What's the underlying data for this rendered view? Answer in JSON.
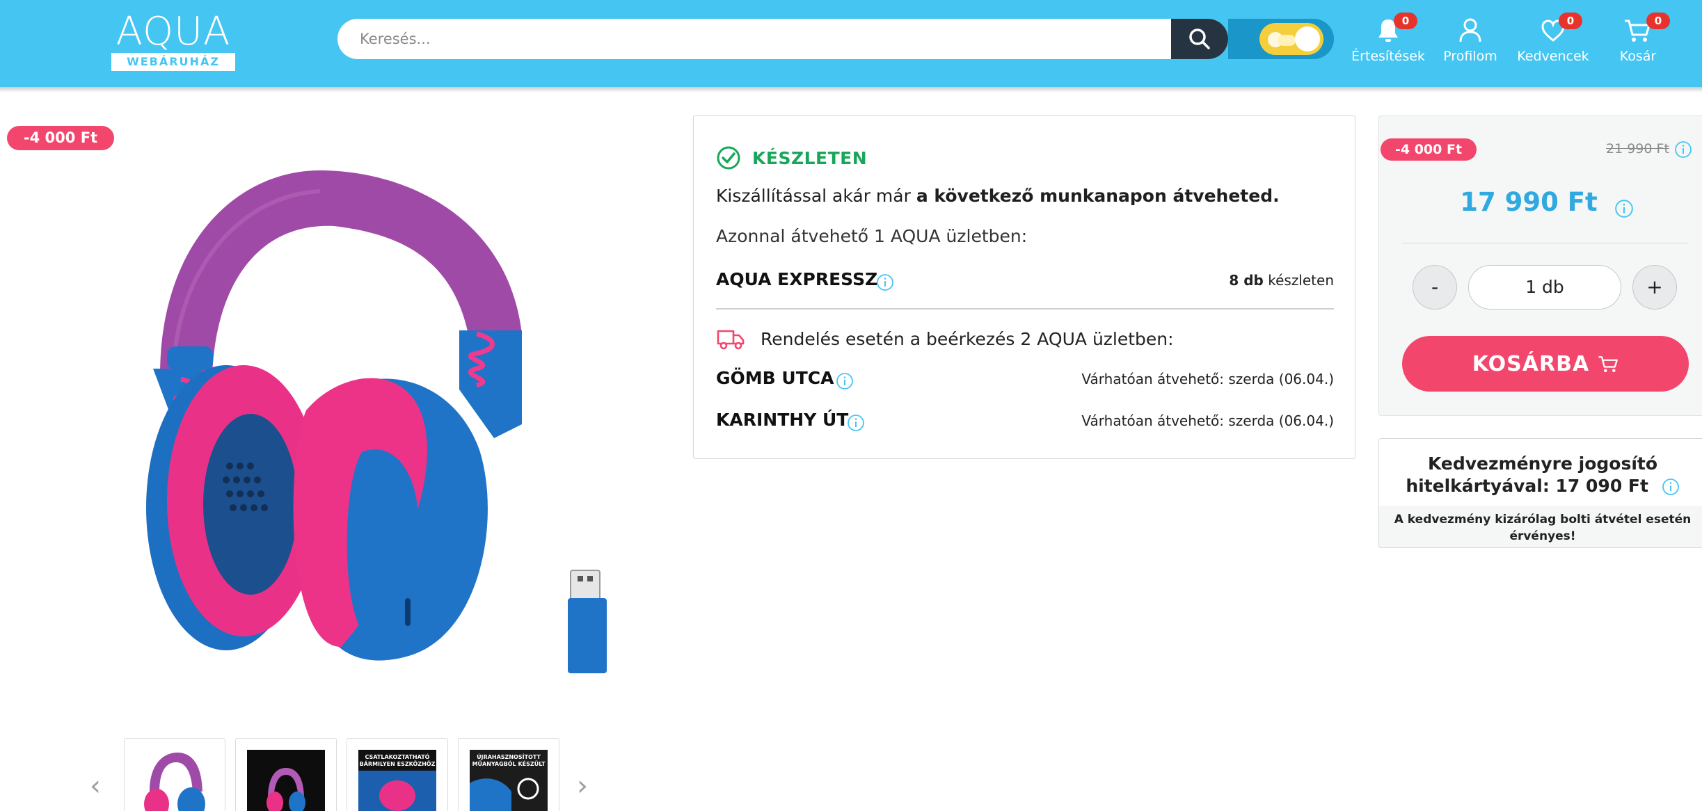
{
  "header": {
    "logo_text": "AQUA",
    "logo_subtitle": "WEBÁRUHÁZ",
    "search_placeholder": "Keresés...",
    "items": [
      {
        "label": "Értesítések",
        "badge": "0",
        "icon": "bell-icon"
      },
      {
        "label": "Profilom",
        "icon": "user-icon"
      },
      {
        "label": "Kedvencek",
        "badge": "0",
        "icon": "heart-icon"
      },
      {
        "label": "Kosár",
        "badge": "0",
        "icon": "cart-icon"
      }
    ],
    "accent_color": "#45c5f1",
    "badge_color": "#e7332c"
  },
  "gallery": {
    "discount_badge": "-4 000 Ft",
    "thumbnails": [
      {
        "text": ""
      },
      {
        "text": ""
      },
      {
        "text": "CSATLAKOZTATHATÓ BÁRMILYEN ESZKÖZHÖZ"
      },
      {
        "text": "ÚJRAHASZNOSÍTOTT MŰANYAGBÓL KÉSZÜLT"
      }
    ]
  },
  "availability": {
    "status": "KÉSZLETEN",
    "delivery_text_prefix": "Kiszállítással akár már ",
    "delivery_text_bold": "a következő munkanapon átveheted.",
    "immediate_text": "Azonnal átvehető 1 AQUA üzletben:",
    "stores_immediate": [
      {
        "name": "AQUA EXPRESSZ",
        "qty": "8 db",
        "qty_suffix": "készleten"
      }
    ],
    "order_text": "Rendelés esetén a beérkezés 2 AQUA üzletben:",
    "stores_order": [
      {
        "name": "GÖMB UTCA",
        "eta": "Várhatóan átvehető: szerda (06.04.)"
      },
      {
        "name": "KARINTHY ÚT",
        "eta": "Várhatóan átvehető: szerda (06.04.)"
      }
    ],
    "status_color": "#1aa65a"
  },
  "pricing": {
    "discount_badge": "-4 000 Ft",
    "old_price": "21 990 Ft",
    "price": "17 990 Ft",
    "qty_minus": "-",
    "qty_value": "1 db",
    "qty_plus": "+",
    "add_to_cart": "KOSÁRBA",
    "price_color": "#2fa9e0",
    "cta_color": "#f3466d"
  },
  "credit": {
    "title_line1": "Kedvezményre jogosító",
    "title_line2": "hitelkártyával: 17 090 Ft",
    "note": "A kedvezmény kizárólag bolti átvétel esetén érvényes!"
  }
}
